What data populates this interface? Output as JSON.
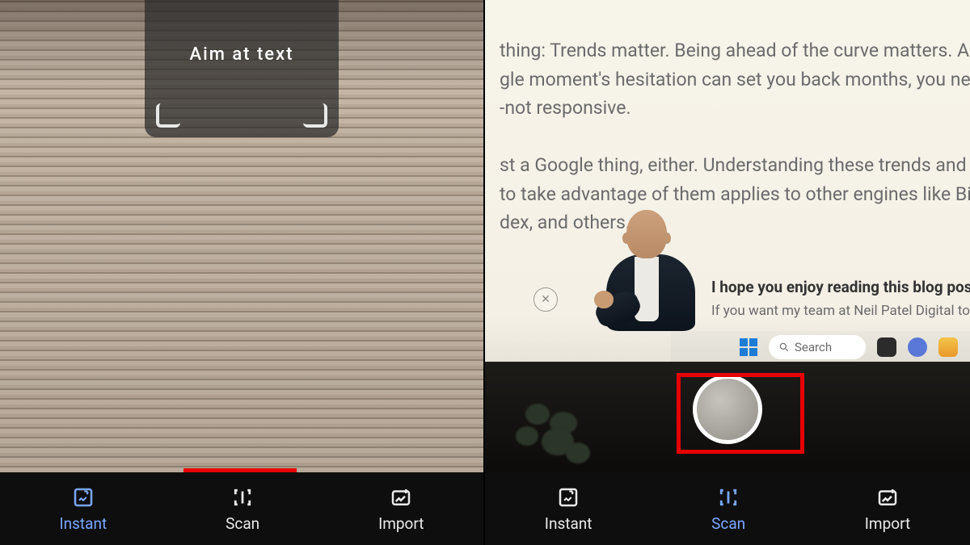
{
  "left": {
    "hint": "Aim at text",
    "nav": {
      "instant": "Instant",
      "scan": "Scan",
      "import": "Import"
    },
    "active_tab": "instant"
  },
  "right": {
    "article": {
      "p1a": "thing: Trends matter. Being ahead of the curve matters. And",
      "p1b": "gle moment's hesitation can set you back months, you nee",
      "p1c": "-not responsive.",
      "p2a": "st a Google thing, either. Understanding these trends and th",
      "p2b": "to take advantage of them applies to other engines like Bing",
      "p2c": "dex, and others."
    },
    "popup": {
      "title": "I hope you enjoy reading this blog pos",
      "sub": "If you want my team at Neil Patel Digital to help"
    },
    "taskbar": {
      "search": "Search"
    },
    "nav": {
      "instant": "Instant",
      "scan": "Scan",
      "import": "Import"
    },
    "active_tab": "scan"
  }
}
